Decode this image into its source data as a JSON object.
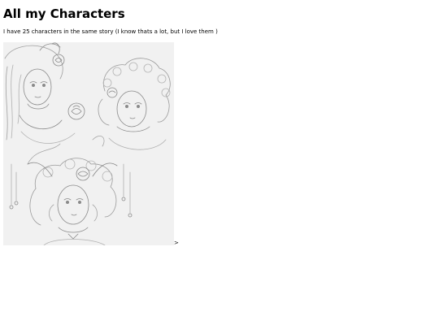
{
  "page": {
    "title": "All my Characters",
    "description": "I have 25 characters in the same story (I know thats a lot, but I love them )",
    "trailing_text": ">"
  },
  "artwork": {
    "kind": "pencil sketch of three characters",
    "icon": "sketch-image"
  },
  "colors": {
    "background": "#ffffff",
    "text": "#000000",
    "paper": "#f4f4f4",
    "pencil": "#8a8a8a"
  }
}
